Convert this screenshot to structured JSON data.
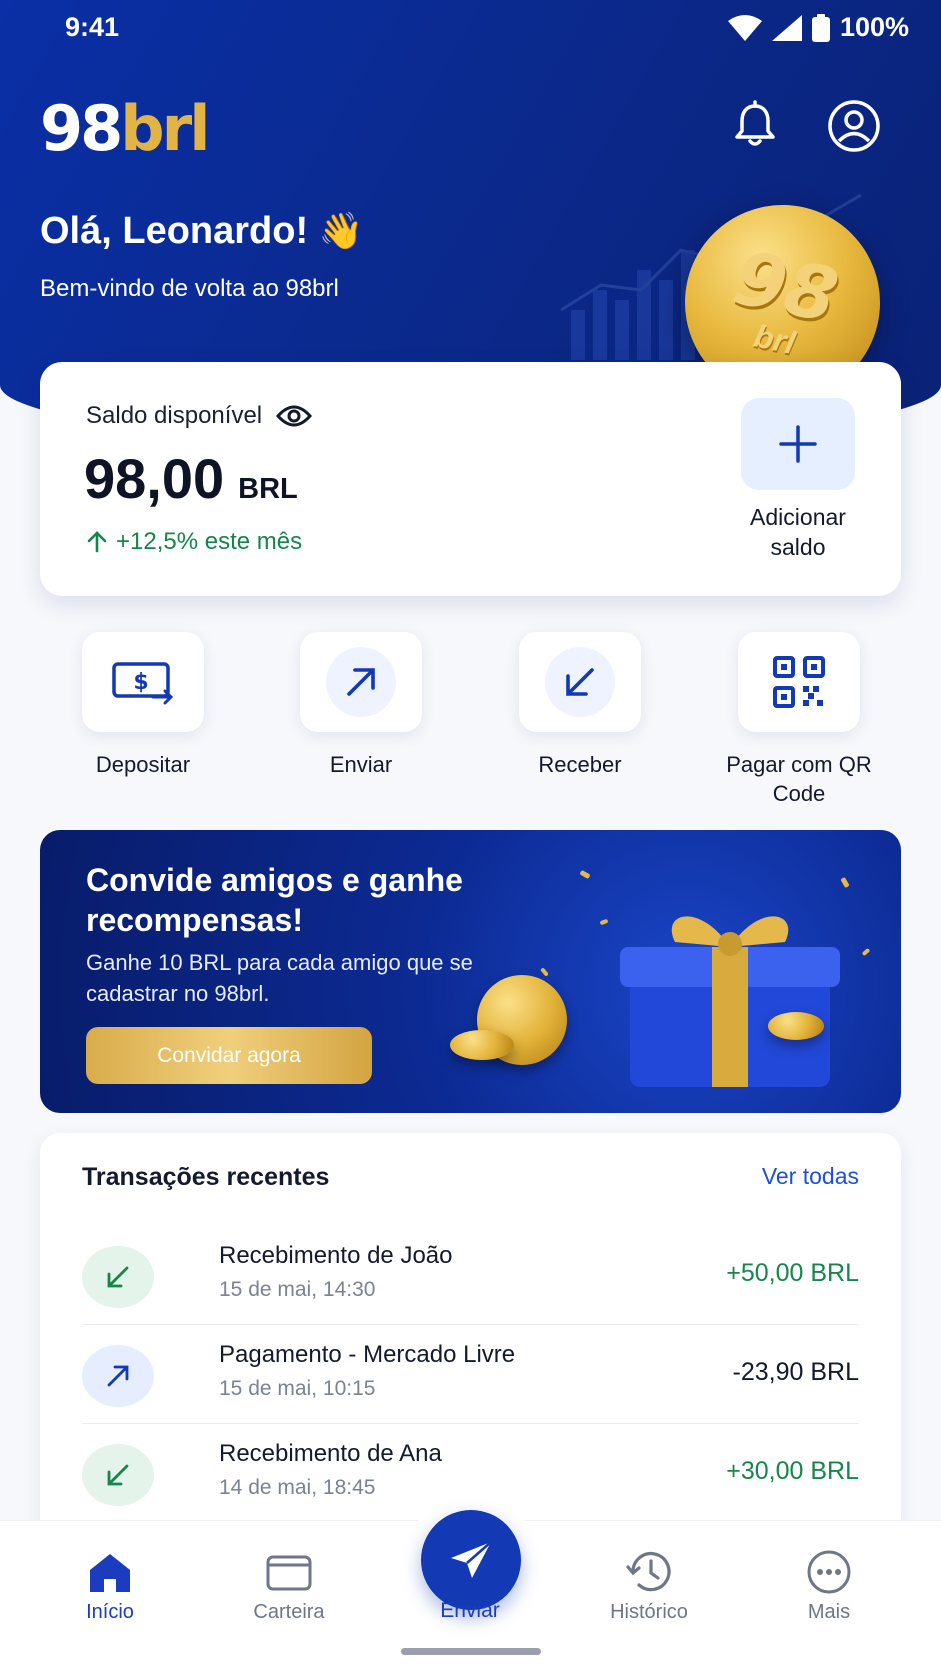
{
  "status_bar": {
    "time": "9:41",
    "battery": "100%"
  },
  "header": {
    "logo_main": "98",
    "logo_accent": "brl",
    "greeting": "Olá, Leonardo!",
    "greeting_emoji": "👋",
    "welcome": "Bem-vindo de volta ao 98brl",
    "coin_text_top": "98",
    "coin_text_bottom": "brl"
  },
  "balance": {
    "label": "Saldo disponível",
    "amount": "98,00",
    "currency": "BRL",
    "change": "+12,5% este mês",
    "add_label": "Adicionar saldo"
  },
  "actions": [
    {
      "label": "Depositar",
      "icon": "cash-deposit-icon"
    },
    {
      "label": "Enviar",
      "icon": "arrow-up-right-icon"
    },
    {
      "label": "Receber",
      "icon": "arrow-down-left-icon"
    },
    {
      "label": "Pagar com QR Code",
      "icon": "qr-code-icon"
    }
  ],
  "promo": {
    "title": "Convide amigos e ganhe recompensas!",
    "body": "Ganhe 10 BRL para cada amigo que se cadastrar no 98brl.",
    "cta": "Convidar agora"
  },
  "transactions": {
    "title": "Transações recentes",
    "view_all": "Ver todas",
    "items": [
      {
        "name": "Recebimento de João",
        "date": "15 de mai, 14:30",
        "amount": "+50,00 BRL",
        "direction": "in"
      },
      {
        "name": "Pagamento - Mercado Livre",
        "date": "15 de mai, 10:15",
        "amount": "-23,90 BRL",
        "direction": "out"
      },
      {
        "name": "Recebimento de Ana",
        "date": "14 de mai, 18:45",
        "amount": "+30,00 BRL",
        "direction": "in"
      }
    ]
  },
  "nav": {
    "home": "Início",
    "wallet": "Carteira",
    "send": "Enviar",
    "history": "Histórico",
    "more": "Mais"
  },
  "colors": {
    "primary": "#1439b5",
    "hero": "#0b2a8f",
    "gold": "#e2b446",
    "positive": "#17864c",
    "link": "#1f4fd6"
  }
}
